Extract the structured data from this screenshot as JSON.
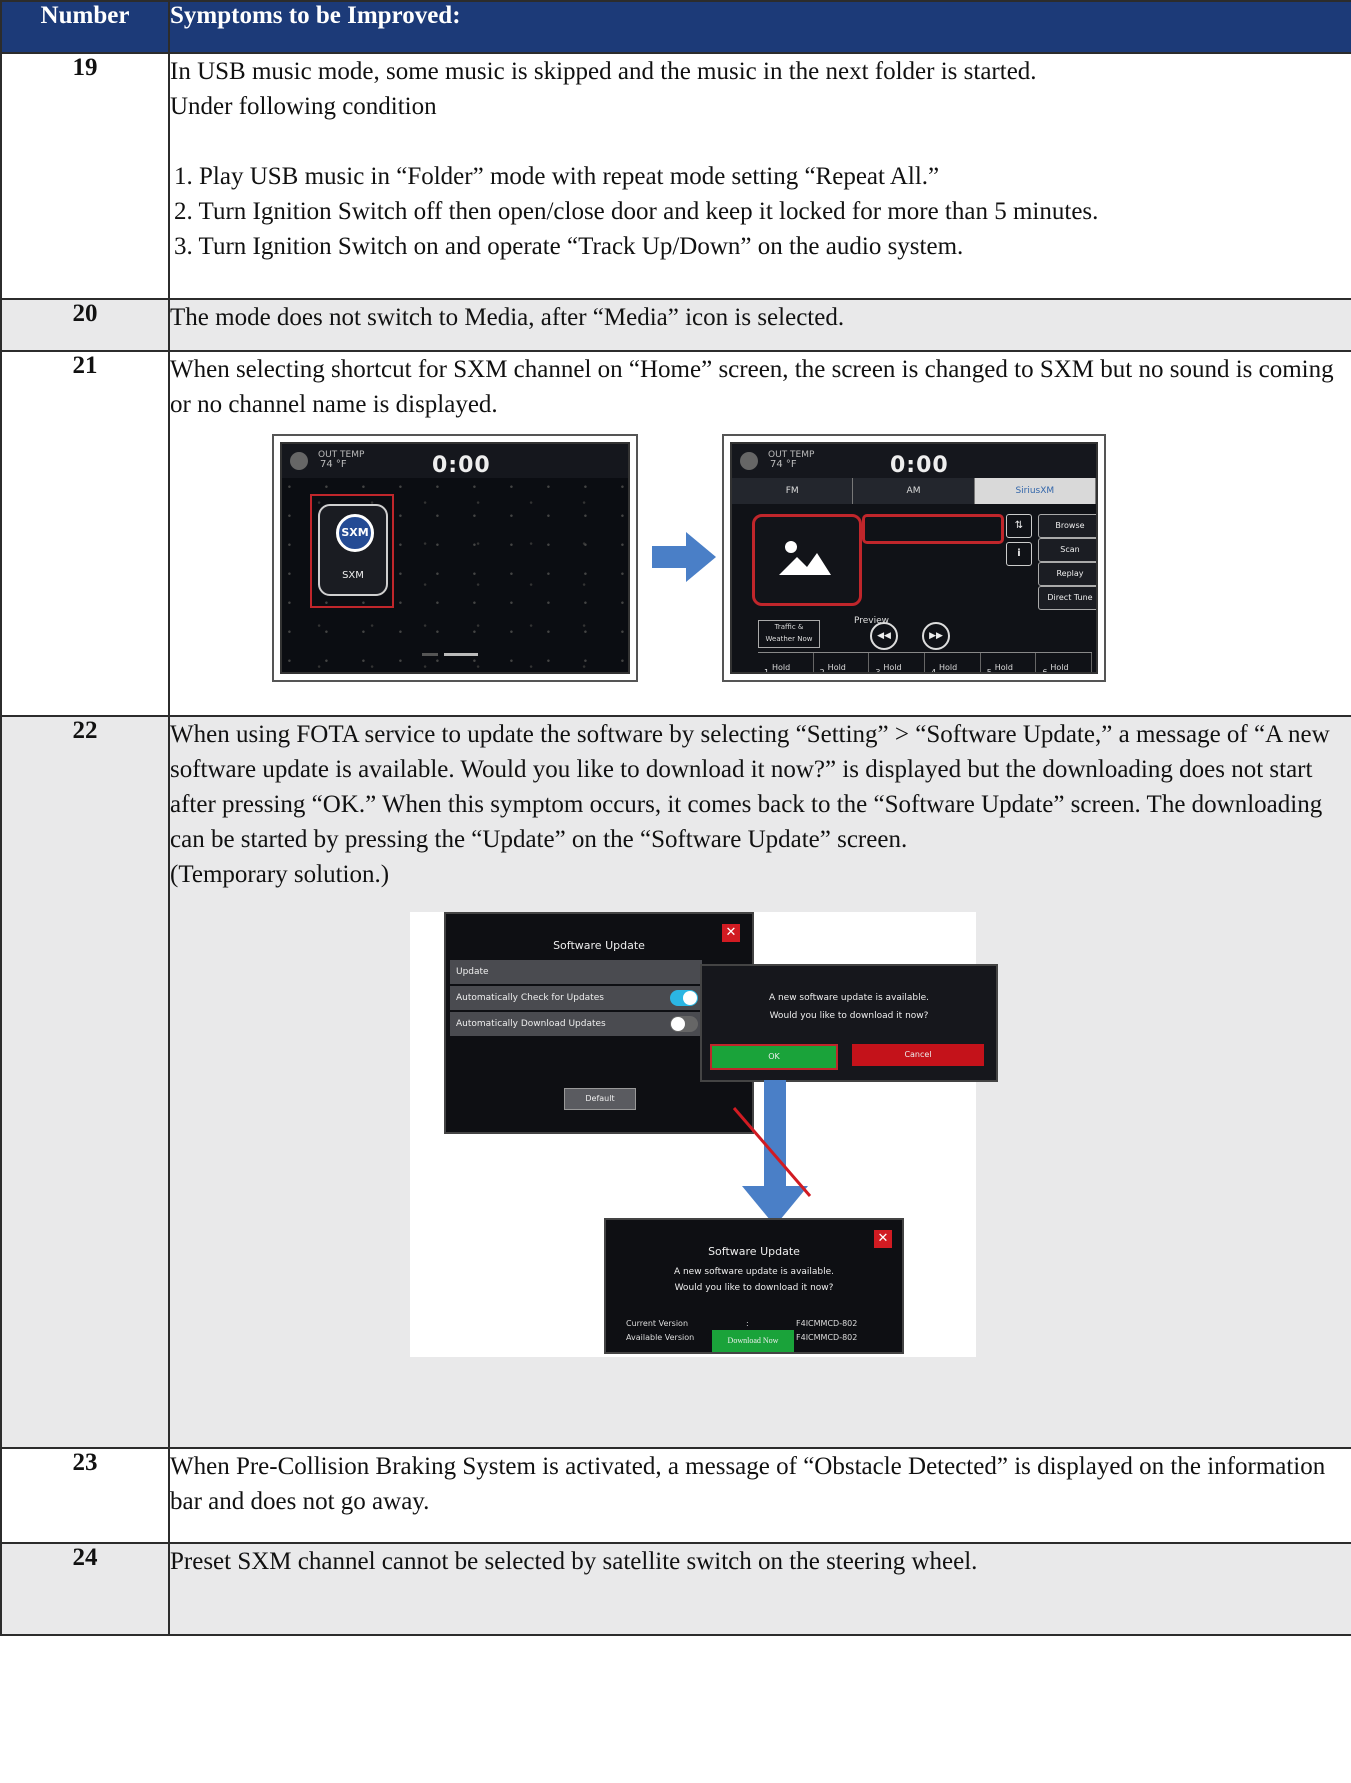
{
  "table": {
    "header_number": "Number",
    "header_symptoms": "Symptoms to be Improved:"
  },
  "rows": [
    {
      "number": "19",
      "text_lines": [
        "In USB music mode, some music is skipped and the music in the next folder is started.",
        "Under following condition"
      ],
      "steps": [
        "1. Play USB music in “Folder” mode with repeat mode setting “Repeat All.”",
        "2. Turn Ignition Switch off then open/close door and keep it locked for more than 5 minutes.",
        "3. Turn Ignition Switch on and operate “Track Up/Down” on the audio system."
      ]
    },
    {
      "number": "20",
      "text": "The mode does not switch to Media, after “Media” icon is selected."
    },
    {
      "number": "21",
      "text": "When selecting shortcut for SXM channel on “Home” screen, the screen is changed to SXM but no sound is coming or no channel name is displayed.",
      "home_screen": {
        "temp_label": "OUT TEMP",
        "temp_value": "74 °F",
        "clock": "0:00",
        "sxm_badge": "SXM",
        "sxm_label": "SXM"
      },
      "radio_screen": {
        "temp_label": "OUT TEMP",
        "temp_value": "74 °F",
        "clock": "0:00",
        "tabs": [
          "FM",
          "AM",
          "SiriusXM"
        ],
        "side_buttons": [
          "Browse",
          "Scan",
          "Replay",
          "Direct Tune"
        ],
        "preview": "Preview",
        "traffic_line1": "Traffic &",
        "traffic_line2": "Weather Now",
        "presets": [
          {
            "n": "1",
            "h": "Hold"
          },
          {
            "n": "2",
            "h": "Hold"
          },
          {
            "n": "3",
            "h": "Hold"
          },
          {
            "n": "4",
            "h": "Hold"
          },
          {
            "n": "5",
            "h": "Hold"
          },
          {
            "n": "6",
            "h": "Hold"
          }
        ]
      },
      "icons": {
        "arrow": "arrow-right-icon",
        "image": "image-placeholder-icon"
      },
      "colors": {
        "arrow": "#4a7fc7",
        "highlight": "#c0262b"
      }
    },
    {
      "number": "22",
      "text": "When using FOTA service to update the software by selecting “Setting” > “Software Update,” a message of “A new software update is available. Would you like to download it now?” is displayed but the downloading does not start after pressing “OK.” When this symptom occurs, it comes back to the “Software Update” screen. The downloading can be started by pressing the “Update” on the “Software Update” screen.",
      "note": "(Temporary solution.)",
      "settings_dialog": {
        "title": "Software Update",
        "rows": [
          "Update",
          "Automatically Check for Updates",
          "Automatically Download Updates"
        ],
        "default_button": "Default"
      },
      "popup": {
        "line1": "A new software update is available.",
        "line2": "Would you like to download it now?",
        "ok": "OK",
        "cancel": "Cancel"
      },
      "result_dialog": {
        "title": "Software Update",
        "line1": "A new software update is available.",
        "line2": "Would you like to download it now?",
        "current_label": "Current Version",
        "current_value": "F4ICMMCD-802",
        "available_label": "Available Version",
        "available_value": "F4ICMMCD-802",
        "download_button": "Download Now"
      },
      "colors": {
        "arrow": "#4a7fc7",
        "toggle_on": "#2bb6e3",
        "ok": "#1aa33a",
        "cancel": "#c4121a"
      }
    },
    {
      "number": "23",
      "text": "When Pre-Collision Braking System is activated, a message of “Obstacle Detected” is displayed on the information bar and does not go away."
    },
    {
      "number": "24",
      "text": "Preset SXM channel cannot be selected by satellite switch on the steering wheel."
    }
  ],
  "colors": {
    "header_bg": "#1c3a78",
    "alt_row_bg": "#e9e9ea"
  }
}
